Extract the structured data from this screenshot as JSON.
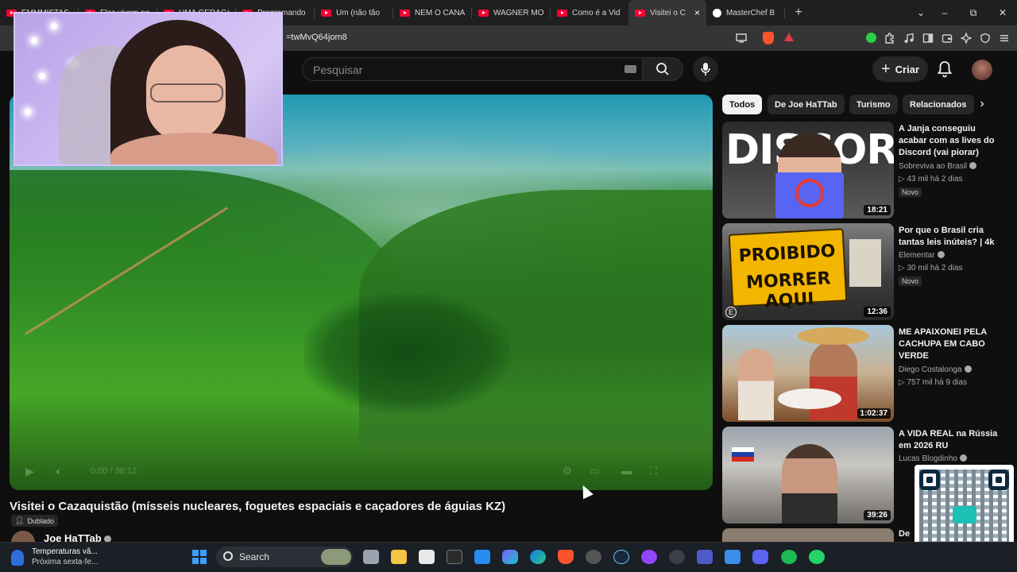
{
  "browser": {
    "tabs": [
      {
        "label": "EMMMISTAS",
        "icon": "youtube-icon"
      },
      {
        "label": "Eles vivem no",
        "icon": "youtube-icon"
      },
      {
        "label": "UMA GERAÇÃ",
        "icon": "youtube-icon"
      },
      {
        "label": "Programando",
        "icon": "youtube-icon"
      },
      {
        "label": "Um (não tão",
        "icon": "youtube-icon"
      },
      {
        "label": "NEM O CANA",
        "icon": "youtube-icon"
      },
      {
        "label": "WAGNER MO",
        "icon": "youtube-icon"
      },
      {
        "label": "Como é a Vid",
        "icon": "youtube-icon"
      },
      {
        "label": "Visitei o C",
        "icon": "youtube-icon",
        "active": true
      },
      {
        "label": "MasterChef B",
        "icon": "github-icon"
      }
    ],
    "tab_close": "×",
    "new_tab": "+",
    "url": "=twMvQ64jom8",
    "window_controls": {
      "minimize": "–",
      "maximize": "⧉",
      "close": "✕",
      "dropdown": "⌄"
    }
  },
  "youtube": {
    "search_placeholder": "Pesquisar",
    "create_label": "Criar",
    "video": {
      "title": "Visitei o Cazaquistão (mísseis nucleares, foguetes espaciais e caçadores de águias KZ)",
      "dub_badge": "Dublado",
      "channel": "Joe HaTTab",
      "time": "0:00 / 36:12"
    },
    "chips": [
      "Todos",
      "De Joe HaTTab",
      "Turismo",
      "Relacionados"
    ],
    "recommendations": [
      {
        "title": "A Janja conseguiu acabar com as lives do Discord (vai piorar)",
        "channel": "Sobreviva ao Brasil",
        "meta": "▷ 43 mil  há 2 dias",
        "badge": "Novo",
        "duration": "18:21",
        "thumb_text": "DISCORD"
      },
      {
        "title": "Por que o Brasil cria tantas leis inúteis? | 4k",
        "channel": "Elementar",
        "meta": "▷ 30 mil  há 2 dias",
        "badge": "Novo",
        "duration": "12:36",
        "thumb_text": [
          "PROIBIDO",
          "MORRER AQUI"
        ]
      },
      {
        "title": "ME APAIXONEI PELA CACHUPA EM CABO VERDE",
        "channel": "Diego Costalonga",
        "meta": "▷ 757 mil  há 9 dias",
        "badge": "",
        "duration": "1:02:37"
      },
      {
        "title": "A VIDA REAL na Rússia em 2026 RU",
        "channel": "Lucas Blogdinho",
        "meta": "",
        "badge": "",
        "duration": "39:26"
      }
    ]
  },
  "taskbar": {
    "weather_line1": "Temperaturas vã...",
    "weather_line2": "Próxima sexta-fe...",
    "search_label": "Search"
  }
}
